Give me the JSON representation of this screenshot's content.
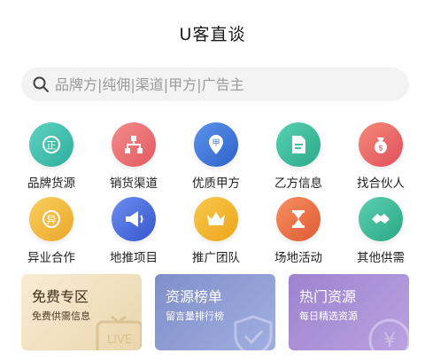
{
  "header": {
    "title": "U客直谈"
  },
  "search": {
    "placeholder": "品牌方|纯佣|渠道|甲方|广告主"
  },
  "grid": [
    [
      {
        "label": "品牌货源",
        "icon": "brand-source-icon",
        "color": "#45c1b0"
      },
      {
        "label": "销货渠道",
        "icon": "sales-channel-icon",
        "color": "#ec6e72"
      },
      {
        "label": "优质甲方",
        "icon": "quality-partya-icon",
        "color": "#3f78d8"
      },
      {
        "label": "乙方信息",
        "icon": "partyb-info-icon",
        "color": "#3dbfa0"
      },
      {
        "label": "找合伙人",
        "icon": "find-partner-icon",
        "color": "#ee6a6a"
      }
    ],
    [
      {
        "label": "异业合作",
        "icon": "cross-industry-icon",
        "color": "#f4bb3c"
      },
      {
        "label": "地推项目",
        "icon": "ground-promotion-icon",
        "color": "#4b6fe0"
      },
      {
        "label": "推广团队",
        "icon": "promotion-team-icon",
        "color": "#f4b12c"
      },
      {
        "label": "场地活动",
        "icon": "venue-event-icon",
        "color": "#f0784a"
      },
      {
        "label": "其他供需",
        "icon": "other-supply-icon",
        "color": "#3cbc9b"
      }
    ]
  ],
  "cards": [
    {
      "title": "免费专区",
      "subtitle": "免费供需信息",
      "icon": "live-tv-icon"
    },
    {
      "title": "资源榜单",
      "subtitle": "留言量排行榜",
      "icon": "shield-check-icon"
    },
    {
      "title": "热门资源",
      "subtitle": "每日精选资源",
      "icon": "yen-coin-icon"
    }
  ]
}
